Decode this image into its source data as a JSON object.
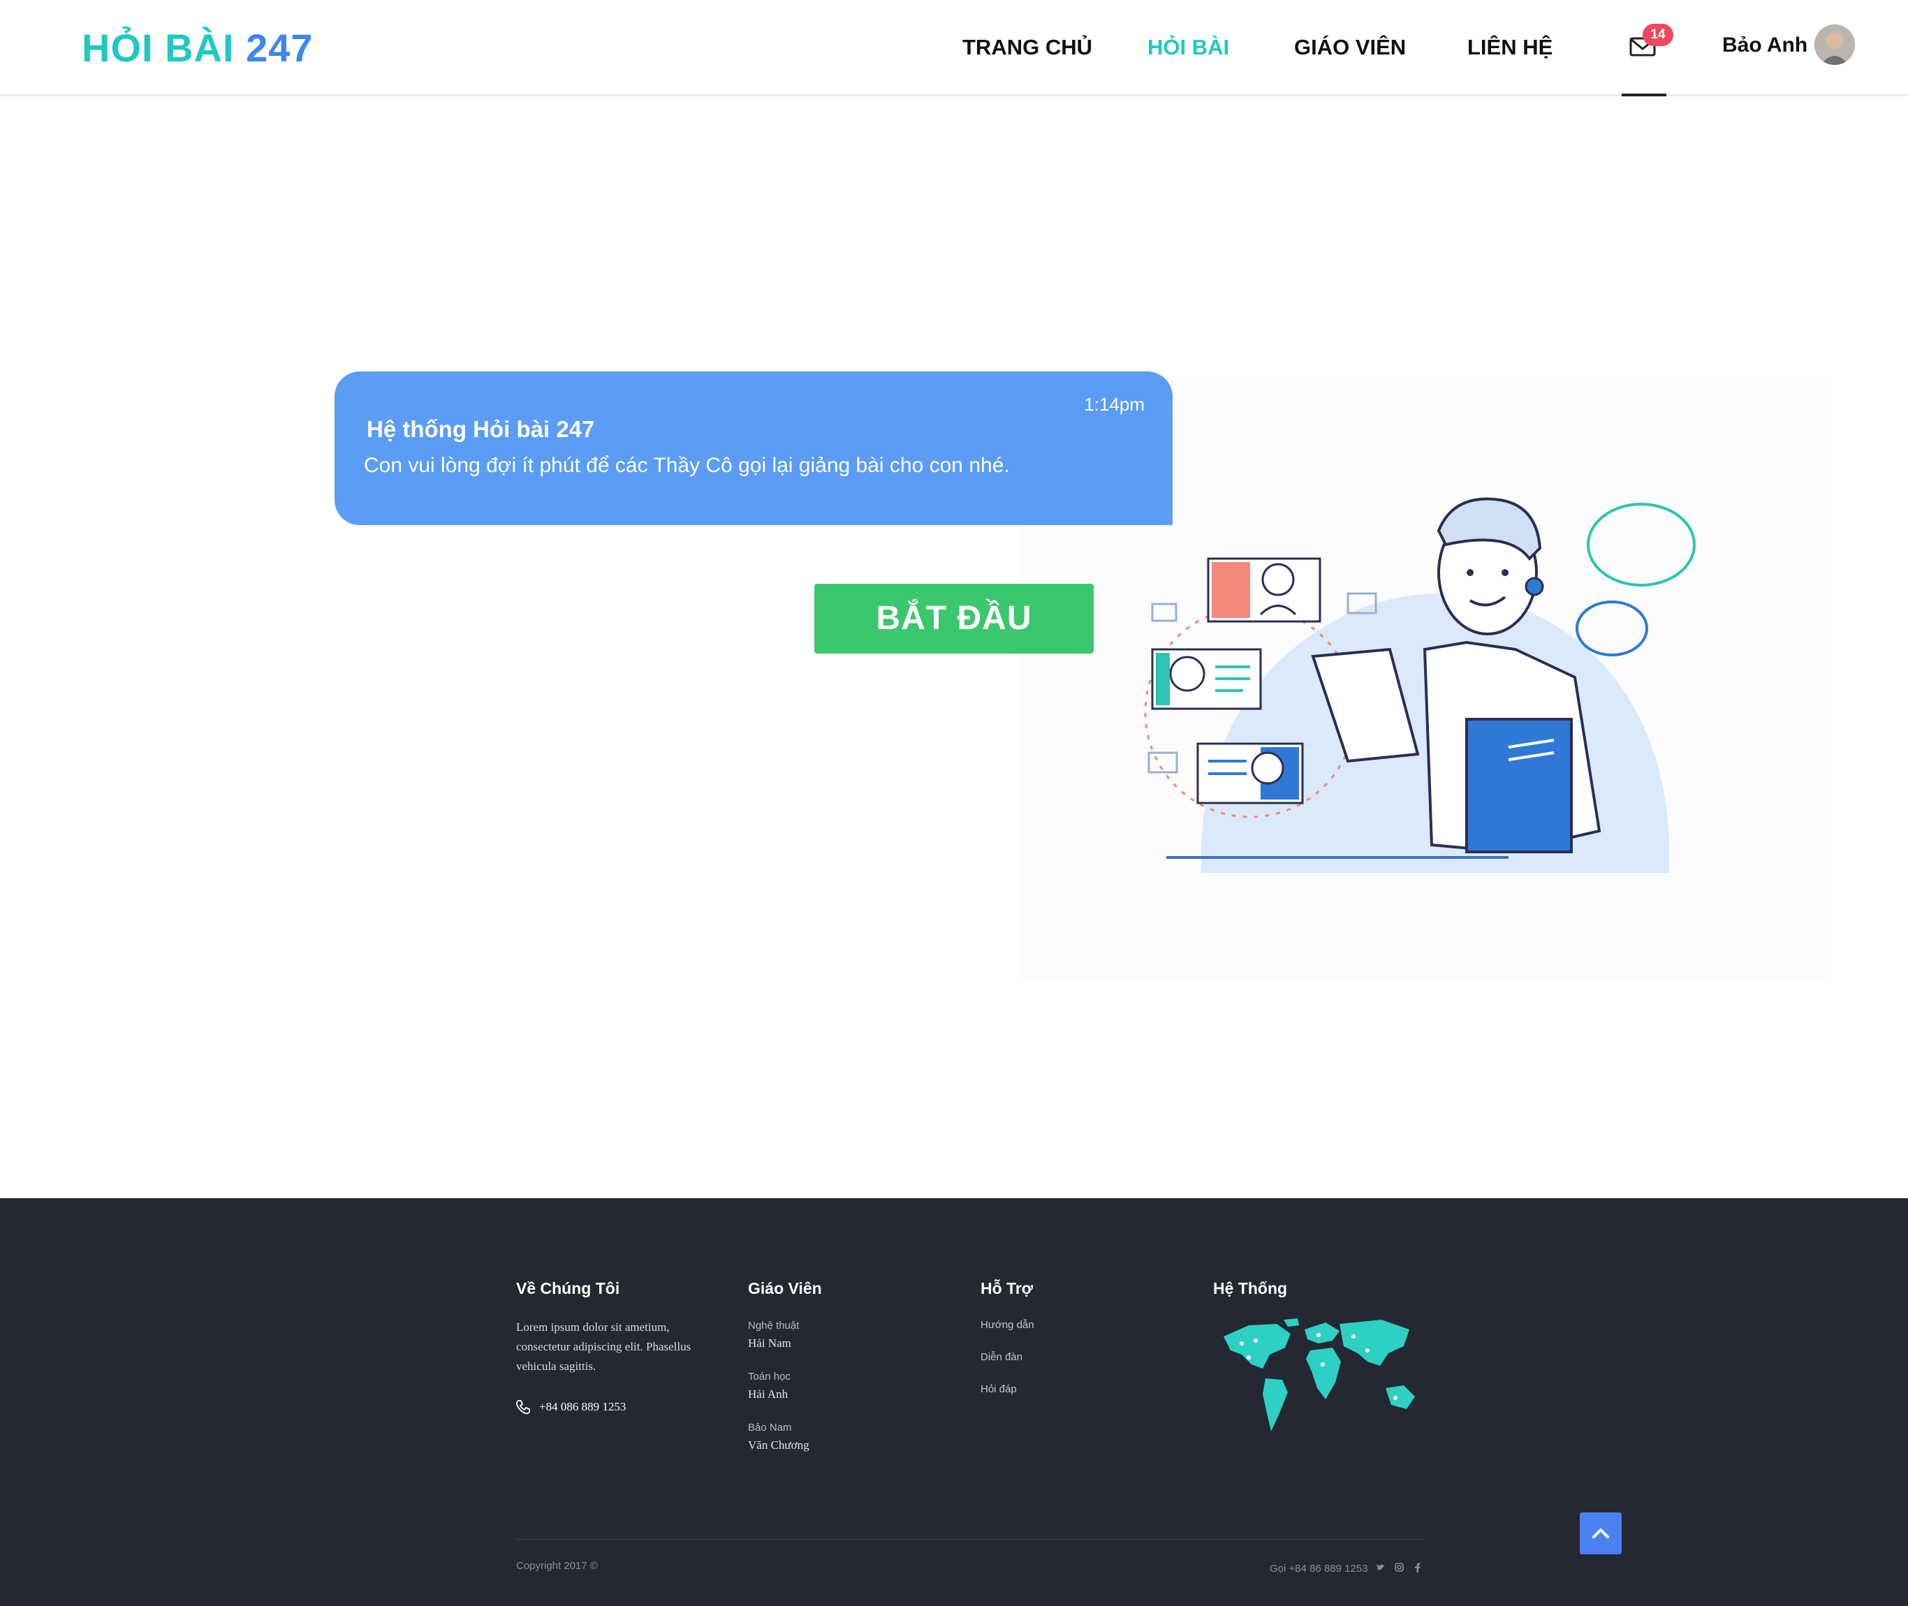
{
  "header": {
    "logo_part1": "HỎI BÀI",
    "logo_part2": "247",
    "nav": [
      {
        "label": "TRANG CHỦ"
      },
      {
        "label": "HỎI BÀI"
      },
      {
        "label": "GIÁO VIÊN"
      },
      {
        "label": "LIÊN HỆ"
      }
    ],
    "active_nav": "HỎI BÀI",
    "mail_badge": "14",
    "user_name": "Bảo Anh"
  },
  "chat": {
    "time": "1:14pm",
    "sender": "Hệ thống Hỏi bài 247",
    "message": "Con vui lòng đợi ít phút để các Thầy Cô gọi lại giảng bài cho con nhé."
  },
  "start_button": "BẮT ĐẦU",
  "footer": {
    "about": {
      "title": "Về Chúng Tôi",
      "text_lines": [
        "Lorem ipsum dolor sit ametium,",
        "consectetur adipiscing elit. Phasellus",
        "vehicula sagittis."
      ],
      "phone": "+84 086 889 1253"
    },
    "teachers": {
      "title": "Giáo Viên",
      "items": [
        {
          "subject": "Nghệ thuật",
          "name": "Hải Nam"
        },
        {
          "subject": "Toán học",
          "name": "Hải Anh"
        },
        {
          "subject": "Bảo Nam",
          "name": "Văn Chương"
        }
      ]
    },
    "support": {
      "title": "Hỗ Trợ",
      "links": [
        "Hướng dẫn",
        "Diễn đàn",
        "Hỏi đáp"
      ]
    },
    "system": {
      "title": "Hệ Thống"
    },
    "copyright": "Copyright 2017 ©",
    "call": "Gọi +84 86 889 1253"
  },
  "colors": {
    "brand_teal": "#1ec9c4",
    "brand_blue": "#3d86ea",
    "bubble": "#5a9cf6",
    "start_green": "#3bc76e",
    "footer_bg": "#232833",
    "badge": "#f0475c"
  },
  "icons": [
    "mail-icon",
    "avatar",
    "phone-icon",
    "world-map",
    "twitter-icon",
    "instagram-icon",
    "facebook-icon",
    "arrow-up-icon"
  ]
}
